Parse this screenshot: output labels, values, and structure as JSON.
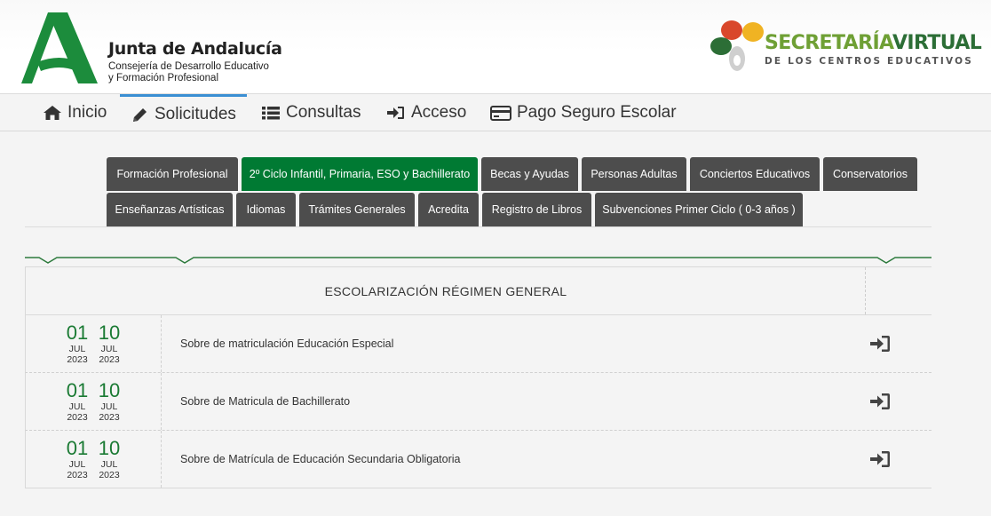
{
  "header": {
    "org_title": "Junta de Andalucía",
    "org_sub_line1": "Consejería de Desarrollo Educativo",
    "org_sub_line2": "y Formación Profesional",
    "sv_title_part1": "SECRETARÍA",
    "sv_title_part2": "VIRTUAL",
    "sv_subtitle": "DE LOS CENTROS EDUCATIVOS"
  },
  "nav": {
    "items": [
      {
        "label": "Inicio",
        "icon": "home-icon"
      },
      {
        "label": "Solicitudes",
        "icon": "pencil-icon",
        "active": true
      },
      {
        "label": "Consultas",
        "icon": "list-icon"
      },
      {
        "label": "Acceso",
        "icon": "sign-in-icon"
      },
      {
        "label": "Pago Seguro Escolar",
        "icon": "credit-card-icon"
      }
    ]
  },
  "tabs": {
    "row1": [
      "Formación Profesional",
      "2º Ciclo Infantil, Primaria, ESO y Bachillerato",
      "Becas y Ayudas",
      "Personas Adultas",
      "Conciertos Educativos",
      "Conservatorios"
    ],
    "row2": [
      "Enseñanzas Artísticas",
      "Idiomas",
      "Trámites Generales",
      "Acredita",
      "Registro de Libros",
      "Subvenciones Primer Ciclo ( 0-3 años )"
    ],
    "active": "2º Ciclo Infantil, Primaria, ESO y Bachillerato"
  },
  "section": {
    "title": "ESCOLARIZACIÓN RÉGIMEN GENERAL",
    "rows": [
      {
        "start": {
          "day": "01",
          "month": "JUL",
          "year": "2023"
        },
        "end": {
          "day": "10",
          "month": "JUL",
          "year": "2023"
        },
        "label": "Sobre de matriculación Educación Especial"
      },
      {
        "start": {
          "day": "01",
          "month": "JUL",
          "year": "2023"
        },
        "end": {
          "day": "10",
          "month": "JUL",
          "year": "2023"
        },
        "label": "Sobre de Matricula de Bachillerato"
      },
      {
        "start": {
          "day": "01",
          "month": "JUL",
          "year": "2023"
        },
        "end": {
          "day": "10",
          "month": "JUL",
          "year": "2023"
        },
        "label": "Sobre de Matrícula de Educación Secundaria Obligatoria"
      }
    ]
  },
  "colors": {
    "accent_green": "#007a33",
    "tab_dark": "#4d4d4d",
    "nav_active": "#3b8fd3"
  }
}
